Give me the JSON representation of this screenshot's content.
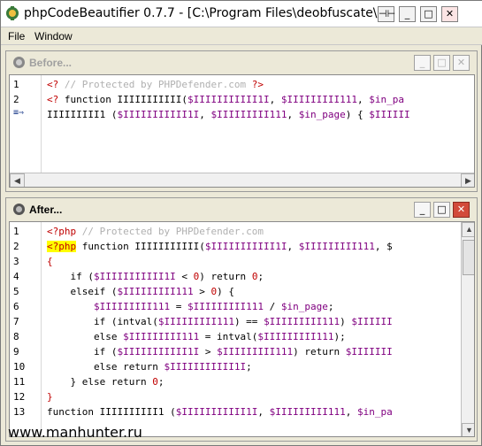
{
  "window": {
    "title": "phpCodeBeautifier 0.7.7 - [C:\\Program Files\\deobfuscate\\separa",
    "pin_glyph": "⊣⊢",
    "minimize_glyph": "_",
    "maximize_glyph": "□",
    "close_glyph": "✕"
  },
  "menu": {
    "file": "File",
    "window": "Window"
  },
  "before": {
    "title": "Before...",
    "line_numbers": [
      "1",
      "2"
    ],
    "wrap_marker": "≡⇒",
    "lines": [
      {
        "parts": [
          {
            "c": "tag",
            "t": "<? "
          },
          {
            "c": "cmt",
            "t": "// Protected by PHPDefender.com "
          },
          {
            "c": "tag",
            "t": "?>"
          }
        ]
      },
      {
        "parts": [
          {
            "c": "tag",
            "t": "<? "
          },
          {
            "c": "kw",
            "t": "function IIIIIIIIIII("
          },
          {
            "c": "var",
            "t": "$IIIIIIIIIII1I"
          },
          {
            "c": "kw",
            "t": ", "
          },
          {
            "c": "var",
            "t": "$IIIIIIIII111"
          },
          {
            "c": "kw",
            "t": ", "
          },
          {
            "c": "var",
            "t": "$in_pa"
          }
        ]
      },
      {
        "parts": [
          {
            "c": "kw",
            "t": "IIIIIIIII1 ("
          },
          {
            "c": "var",
            "t": "$IIIIIIIIIII1I"
          },
          {
            "c": "kw",
            "t": ", "
          },
          {
            "c": "var",
            "t": "$IIIIIIIII111"
          },
          {
            "c": "kw",
            "t": ", "
          },
          {
            "c": "var",
            "t": "$in_page"
          },
          {
            "c": "kw",
            "t": ") { "
          },
          {
            "c": "var",
            "t": "$IIIIII"
          }
        ]
      }
    ]
  },
  "after": {
    "title": "After...",
    "line_numbers": [
      "1",
      "2",
      "3",
      "4",
      "5",
      "6",
      "7",
      "8",
      "9",
      "10",
      "11",
      "12",
      "13"
    ],
    "lines": [
      {
        "parts": [
          {
            "c": "tag",
            "t": "<?php "
          },
          {
            "c": "cmt",
            "t": "// Protected by PHPDefender.com"
          }
        ]
      },
      {
        "parts": [
          {
            "c": "tag hl",
            "t": "<?php"
          },
          {
            "c": "kw",
            "t": " function IIIIIIIIIII("
          },
          {
            "c": "var",
            "t": "$IIIIIIIIIII1I"
          },
          {
            "c": "kw",
            "t": ", "
          },
          {
            "c": "var",
            "t": "$IIIIIIIII111"
          },
          {
            "c": "kw",
            "t": ", $"
          }
        ]
      },
      {
        "parts": [
          {
            "c": "tag",
            "t": "{"
          }
        ]
      },
      {
        "parts": [
          {
            "c": "kw",
            "t": "    if ("
          },
          {
            "c": "var",
            "t": "$IIIIIIIIIII1I"
          },
          {
            "c": "kw",
            "t": " < "
          },
          {
            "c": "num",
            "t": "0"
          },
          {
            "c": "kw",
            "t": ") return "
          },
          {
            "c": "num",
            "t": "0"
          },
          {
            "c": "kw",
            "t": ";"
          }
        ]
      },
      {
        "parts": [
          {
            "c": "kw",
            "t": "    elseif ("
          },
          {
            "c": "var",
            "t": "$IIIIIIIII111"
          },
          {
            "c": "kw",
            "t": " > "
          },
          {
            "c": "num",
            "t": "0"
          },
          {
            "c": "kw",
            "t": ") {"
          }
        ]
      },
      {
        "parts": [
          {
            "c": "var",
            "t": "        $IIIIIIIII111"
          },
          {
            "c": "kw",
            "t": " = "
          },
          {
            "c": "var",
            "t": "$IIIIIIIII111"
          },
          {
            "c": "kw",
            "t": " / "
          },
          {
            "c": "var",
            "t": "$in_page"
          },
          {
            "c": "kw",
            "t": ";"
          }
        ]
      },
      {
        "parts": [
          {
            "c": "kw",
            "t": "        if (intval("
          },
          {
            "c": "var",
            "t": "$IIIIIIIII111"
          },
          {
            "c": "kw",
            "t": ") == "
          },
          {
            "c": "var",
            "t": "$IIIIIIIII111"
          },
          {
            "c": "kw",
            "t": ") "
          },
          {
            "c": "var",
            "t": "$IIIIII"
          }
        ]
      },
      {
        "parts": [
          {
            "c": "kw",
            "t": "        else "
          },
          {
            "c": "var",
            "t": "$IIIIIIIII111"
          },
          {
            "c": "kw",
            "t": " = intval("
          },
          {
            "c": "var",
            "t": "$IIIIIIIII111"
          },
          {
            "c": "kw",
            "t": ");"
          }
        ]
      },
      {
        "parts": [
          {
            "c": "kw",
            "t": "        if ("
          },
          {
            "c": "var",
            "t": "$IIIIIIIIIII1I"
          },
          {
            "c": "kw",
            "t": " > "
          },
          {
            "c": "var",
            "t": "$IIIIIIIII111"
          },
          {
            "c": "kw",
            "t": ") return "
          },
          {
            "c": "var",
            "t": "$IIIIIII"
          }
        ]
      },
      {
        "parts": [
          {
            "c": "kw",
            "t": "        else return "
          },
          {
            "c": "var",
            "t": "$IIIIIIIIIII1I"
          },
          {
            "c": "kw",
            "t": ";"
          }
        ]
      },
      {
        "parts": [
          {
            "c": "kw",
            "t": "    } else return "
          },
          {
            "c": "num",
            "t": "0"
          },
          {
            "c": "kw",
            "t": ";"
          }
        ]
      },
      {
        "parts": [
          {
            "c": "tag",
            "t": "}"
          }
        ]
      },
      {
        "parts": [
          {
            "c": "kw",
            "t": "function IIIIIIIIII1 ("
          },
          {
            "c": "var",
            "t": "$IIIIIIIIIII1I"
          },
          {
            "c": "kw",
            "t": ", "
          },
          {
            "c": "var",
            "t": "$IIIIIIIII111"
          },
          {
            "c": "kw",
            "t": ", "
          },
          {
            "c": "var",
            "t": "$in_pa"
          }
        ]
      }
    ]
  },
  "scroll": {
    "left_glyph": "◀",
    "right_glyph": "▶",
    "up_glyph": "▲",
    "down_glyph": "▼"
  },
  "watermark": "www.manhunter.ru",
  "colors": {
    "comment": "#b0b0b0",
    "tag": "#c00000",
    "variable": "#800080",
    "highlight": "#ffff00"
  }
}
